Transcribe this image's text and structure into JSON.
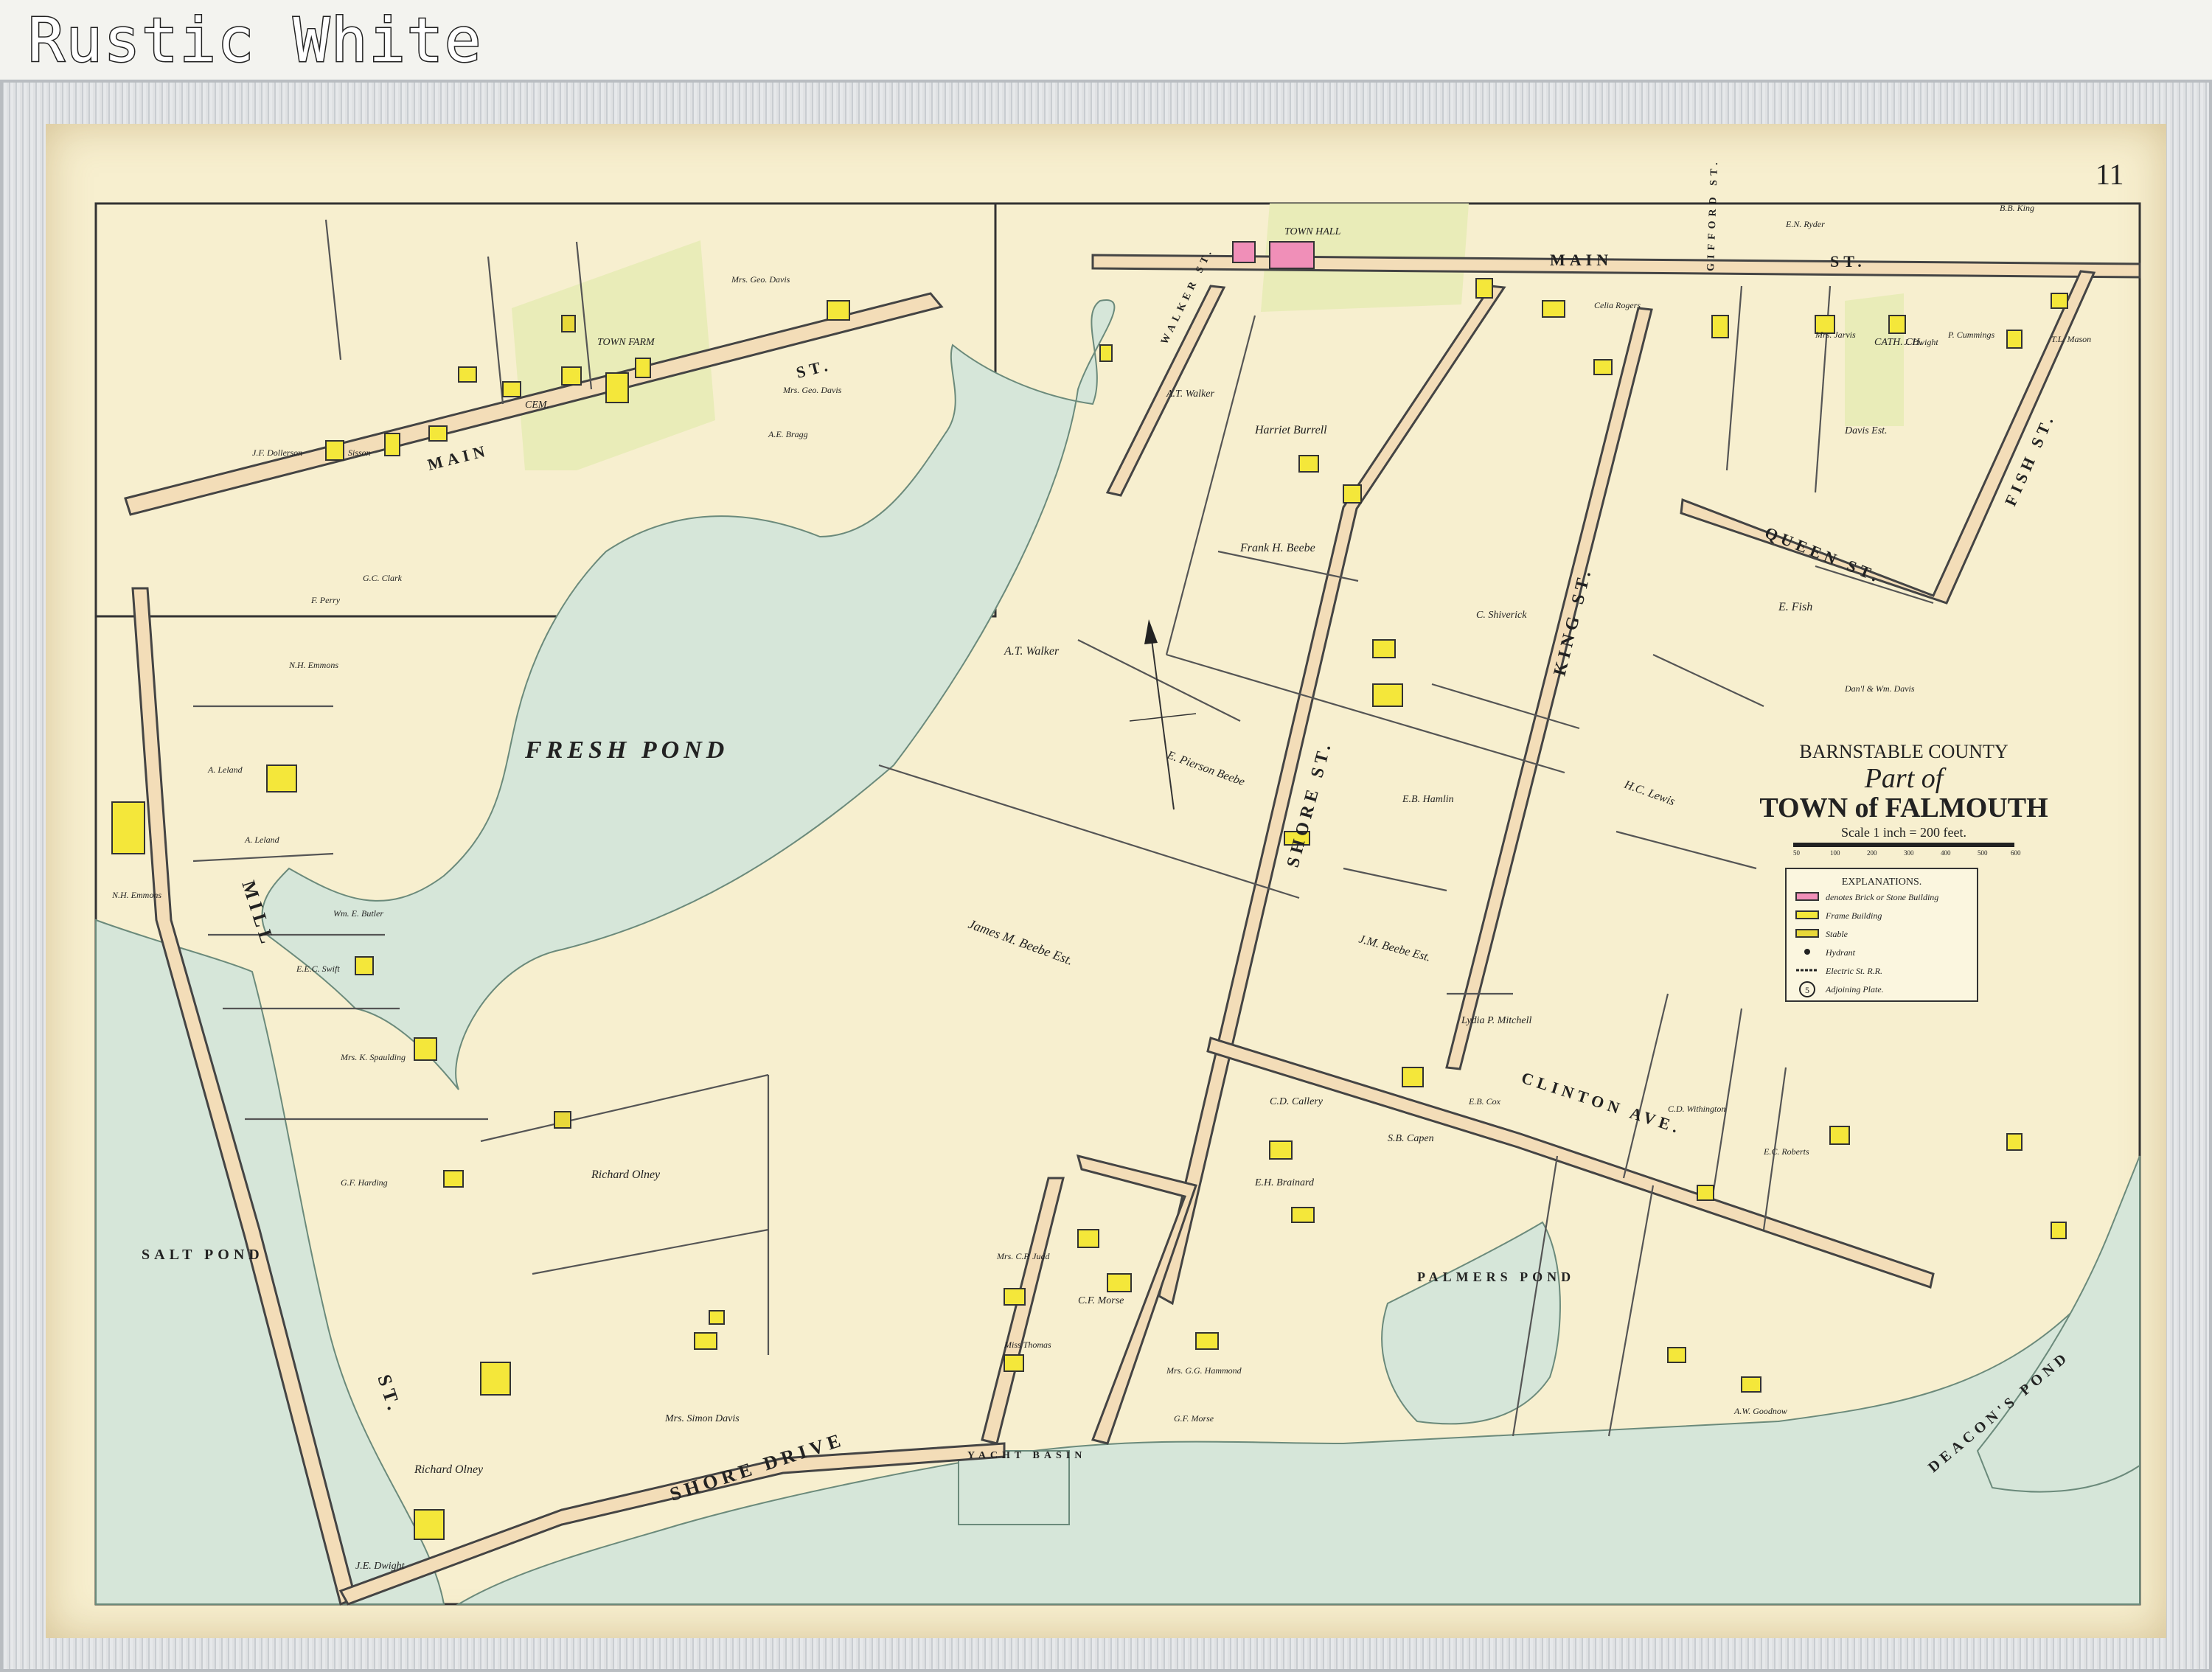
{
  "caption": "Rustic White",
  "map": {
    "plate_number": "11",
    "county": "BARNSTABLE COUNTY",
    "title_part": "Part of",
    "title_town": "TOWN of FALMOUTH",
    "scale": "Scale 1 inch = 200 feet.",
    "scale_ticks": [
      "50",
      "100",
      "200",
      "300",
      "400",
      "500",
      "600"
    ],
    "explanations": {
      "heading": "EXPLANATIONS.",
      "items": [
        {
          "key": "brick",
          "text": "denotes Brick or Stone Building"
        },
        {
          "key": "frame",
          "text": "Frame Building"
        },
        {
          "key": "stable",
          "text": "Stable"
        },
        {
          "key": "hydrant",
          "text": "Hydrant"
        },
        {
          "key": "rr",
          "text": "Electric St. R.R."
        },
        {
          "key": "plate",
          "text": "Adjoining Plate."
        }
      ],
      "plate_symbol": "5"
    },
    "streets": {
      "main_left": "MAIN",
      "main_left_st": "ST.",
      "main_right": "MAIN",
      "main_right_st": "ST.",
      "mill": "MILL",
      "mill_st": "ST.",
      "shore_drive": "SHORE DRIVE",
      "shore_st": "SHORE ST.",
      "king_st": "KING ST.",
      "queen_st": "QUEEN ST.",
      "fish_st": "FISH ST.",
      "clinton_ave": "CLINTON AVE.",
      "gifford_st": "GIFFORD ST.",
      "walker_st": "WALKER ST."
    },
    "water": {
      "fresh_pond": "FRESH  POND",
      "salt_pond": "SALT POND",
      "palmers_pond": "PALMERS POND",
      "deacons_pond": "DEACON'S POND",
      "yacht_basin": "YACHT BASIN"
    },
    "labels": {
      "town_hall": "TOWN HALL",
      "town_farm": "TOWN FARM",
      "cem": "CEM.",
      "cath_ch": "CATH. CH.",
      "harriet_burrell": "Harriet Burrell",
      "frank_beebe": "Frank H. Beebe",
      "at_walker": "A.T. Walker",
      "at_walker2": "A.T. Walker",
      "pierson_beebe": "E. Pierson Beebe",
      "james_beebe": "James M. Beebe Est.",
      "jm_beebe_est": "J.M. Beebe Est.",
      "lydia_mitchell": "Lydia P. Mitchell",
      "hc_lewis": "H.C. Lewis",
      "e_fish": "E. Fish",
      "dani_davis": "Dan'l & Wm. Davis",
      "davis_est": "Davis Est.",
      "richard_olney": "Richard Olney",
      "richard_olney2": "Richard Olney",
      "mrs_simon_davis": "Mrs. Simon Davis",
      "je_dwight": "J.E. Dwight",
      "nh_emmons": "N.H. Emmons",
      "nh_emmons2": "N.H. Emmons",
      "a_leland": "A. Leland",
      "a_leland2": "A. Leland",
      "wm_butler": "Wm. E. Butler",
      "eec_swift": "E.E.C. Swift",
      "mrs_spaulding": "Mrs. K. Spaulding",
      "gf_harding": "G.F. Harding",
      "cf_morse": "C.F. Morse",
      "gf_morse": "G.F. Morse",
      "cd_callery": "C.D. Callery",
      "eh_brainard": "E.H. Brainard",
      "sb_capen": "S.B. Capen",
      "eb_cox": "E.B. Cox",
      "cd_withington": "C.D. Withington",
      "ec_roberts": "E.C. Roberts",
      "aw_goodnow": "A.W. Goodnow",
      "mrs_hammond": "Mrs. G.G. Hammond",
      "c_shiverick": "C. Shiverick",
      "eb_hamlin": "E.B. Hamlin",
      "jf_dollerson": "J.F. Dollerson",
      "sisson": "Sisson",
      "gc_clark": "G.C. Clark",
      "f_perry": "F. Perry",
      "mrs_geo_davis": "Mrs. Geo. Davis",
      "mrs_geo_davis2": "Mrs. Geo. Davis",
      "ae_bragg": "A.E. Bragg",
      "celia_rogers": "Celia Rogers",
      "en_ryder": "E.N. Ryder",
      "bb_king": "B.B. King",
      "tl_mason": "T.L. Mason",
      "p_cummings": "P. Cummings",
      "mrs_jarvis": "Mrs. Jarvis",
      "j_dwight": "J. Dwight",
      "miss_thomas": "Miss Thomas",
      "mrs_judd": "Mrs. C.P. Judd"
    }
  }
}
